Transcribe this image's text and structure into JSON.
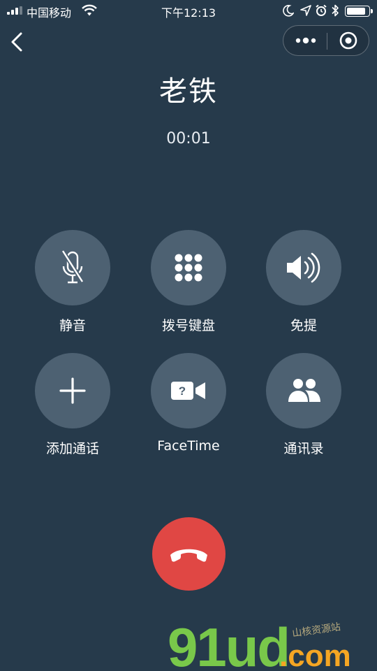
{
  "status_bar": {
    "carrier": "中国移动",
    "time": "下午12:13",
    "icons": [
      "signal-icon",
      "wifi-icon",
      "moon-icon",
      "location-icon",
      "alarm-icon",
      "bluetooth-icon",
      "battery-icon"
    ]
  },
  "nav": {
    "back_icon": "chevron-left-icon",
    "capsule_icons": [
      "more-dots-icon",
      "target-close-icon"
    ]
  },
  "call": {
    "contact_name": "老铁",
    "duration": "00:01"
  },
  "controls": [
    {
      "label": "静音",
      "icon": "mic-muted-icon"
    },
    {
      "label": "拨号键盘",
      "icon": "keypad-icon"
    },
    {
      "label": "免提",
      "icon": "speaker-icon"
    },
    {
      "label": "添加通话",
      "icon": "plus-icon"
    },
    {
      "label": "FaceTime",
      "icon": "facetime-icon"
    },
    {
      "label": "通讯录",
      "icon": "contacts-icon"
    }
  ],
  "end_call": {
    "icon": "hang-up-icon",
    "color": "#e04744"
  },
  "watermark": {
    "text_a": "91ud",
    "text_b": ".com",
    "text_c": "山核资源站"
  },
  "colors": {
    "background": "#263a4b",
    "button": "#4d6172",
    "end_call": "#e04744"
  }
}
